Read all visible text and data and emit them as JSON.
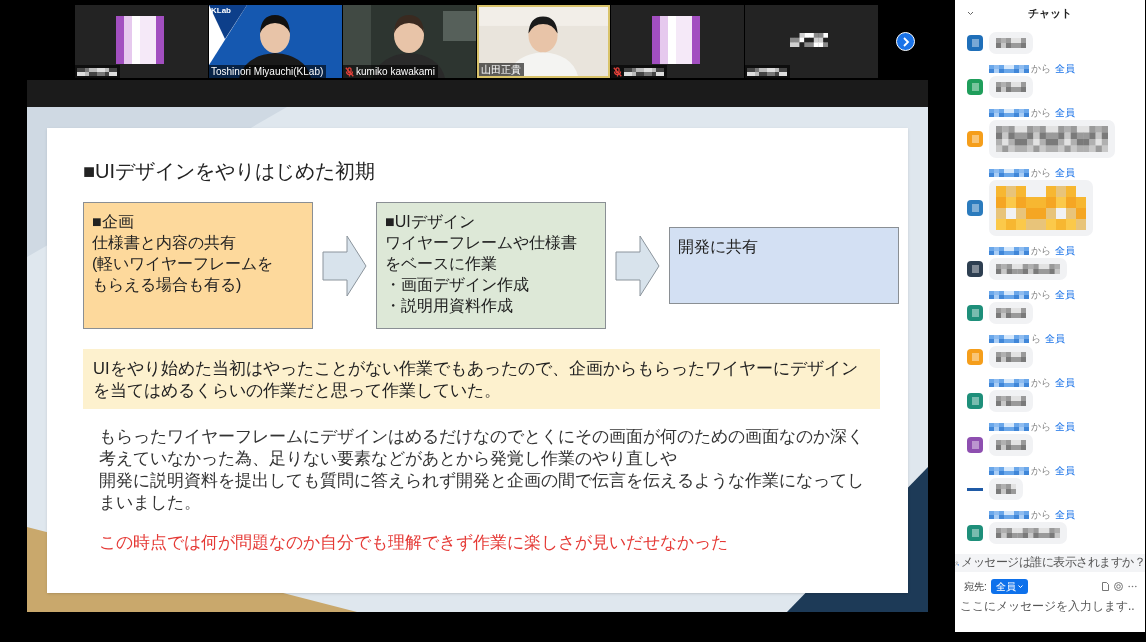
{
  "video_strip": {
    "tiles": [
      {
        "kind": "avatar",
        "muted": false,
        "speaking": false
      },
      {
        "kind": "video",
        "name": "Toshinori Miyauchi(KLab)",
        "logo": "KLab",
        "muted": false,
        "speaking": false
      },
      {
        "kind": "video",
        "name": "kumiko kawakami",
        "muted": true,
        "speaking": false
      },
      {
        "kind": "video",
        "name": "山田正貴",
        "muted": false,
        "speaking": true
      },
      {
        "kind": "avatar",
        "muted": true,
        "speaking": false
      },
      {
        "kind": "name_only",
        "muted": false,
        "speaking": false
      }
    ]
  },
  "slide": {
    "title": "■UIデザインをやりはじめた初期",
    "flow": [
      {
        "color": "#fdd99c",
        "lines": [
          "■企画",
          "仕様書と内容の共有",
          "(軽いワイヤーフレームを",
          "もらえる場合も有る)"
        ]
      },
      {
        "color": "#dde8d7",
        "lines": [
          "■UIデザイン",
          "ワイヤーフレームや仕様書",
          "をベースに作業",
          "・画面デザイン作成",
          "・説明用資料作成"
        ]
      },
      {
        "color": "#d3e0f3",
        "lines": [
          "開発に共有"
        ]
      }
    ],
    "highlight": "UIをやり始めた当初はやったことがない作業でもあったので、企画からもらったワイヤーにデザインを当てはめるくらいの作業だと思って作業していた。",
    "body": [
      "もらったワイヤーフレームにデザインはめるだけなのでとくにその画面が何のための画面なのか深く考えていなかった為、足りない要素などがあとから発覚し作業のやり直しや",
      "開発に説明資料を提出しても質問に答えられず開発と企画の間で伝言を伝えるような作業になってしまいました。"
    ],
    "conclusion": "この時点では何が問題なのか自分でも理解できず作業に楽しさが見いだせなかった"
  },
  "chat": {
    "title": "チャット",
    "messages": [
      {
        "avatar": {
          "kind": "square",
          "color": "#1f6fb9"
        },
        "bubble": {
          "kind": "short"
        }
      },
      {
        "from": "から",
        "to": "全員",
        "avatar": {
          "kind": "square",
          "color": "#1f9e5b"
        },
        "bubble": {
          "kind": "short"
        }
      },
      {
        "from": "から",
        "to": "全員",
        "avatar": {
          "kind": "square",
          "color": "#f59e1b"
        },
        "bubble": {
          "kind": "two-line"
        }
      },
      {
        "from": "から",
        "to": "全員",
        "avatar": {
          "kind": "square",
          "color": "#2b7bbd"
        },
        "bubble": {
          "kind": "sticker"
        }
      },
      {
        "from": "から",
        "to": "全員",
        "avatar": {
          "kind": "square",
          "color": "#2e3f51"
        },
        "bubble": {
          "kind": "wide"
        }
      },
      {
        "from": "から",
        "to": "全員",
        "avatar": {
          "kind": "square",
          "color": "#1e8f7a"
        },
        "bubble": {
          "kind": "short"
        }
      },
      {
        "from": "ら",
        "to": "全員",
        "avatar": {
          "kind": "square",
          "color": "#f59e1b"
        },
        "bubble": {
          "kind": "short"
        }
      },
      {
        "from": "から",
        "to": "全員",
        "avatar": {
          "kind": "square",
          "color": "#1e8f7a"
        },
        "bubble": {
          "kind": "short"
        }
      },
      {
        "from": "から",
        "to": "全員",
        "avatar": {
          "kind": "square",
          "color": "#8e4fb0"
        },
        "bubble": {
          "kind": "short"
        }
      },
      {
        "from": "から",
        "to": "全員",
        "avatar": {
          "kind": "dashes",
          "color": "#1f5aa6"
        },
        "bubble": {
          "kind": "tiny"
        }
      },
      {
        "from": "から",
        "to": "全員",
        "avatar": {
          "kind": "square",
          "color": "#1e8f7a"
        },
        "bubble": {
          "kind": "wide"
        }
      }
    ],
    "visibility_hint": "メッセージは誰に表示されますか？",
    "recipient_label": "宛先:",
    "recipient": "全員",
    "placeholder": "ここにメッセージを入力します.."
  }
}
